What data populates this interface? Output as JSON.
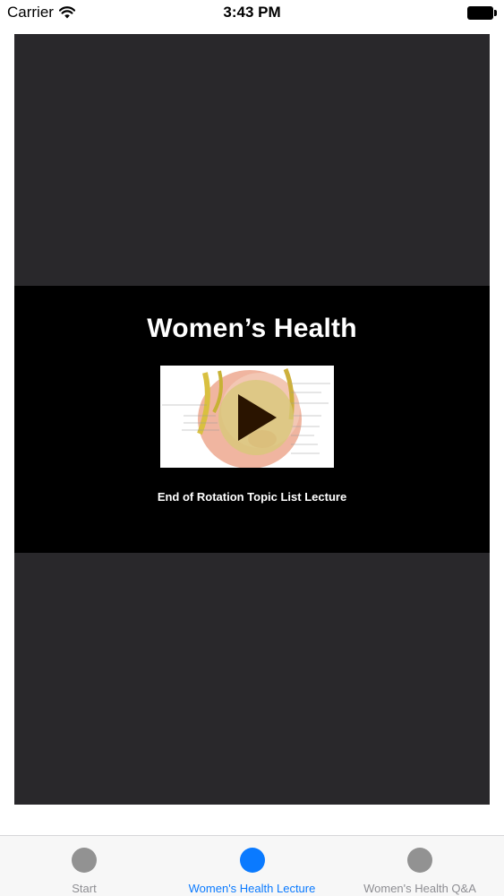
{
  "status_bar": {
    "carrier": "Carrier",
    "time": "3:43 PM",
    "wifi_icon": "wifi-icon",
    "battery_icon": "battery-icon"
  },
  "video": {
    "title": "Women’s Health",
    "subtitle": "End of Rotation Topic List Lecture",
    "play_icon": "play-icon",
    "background_color": "#29282b",
    "frame_color": "#000000"
  },
  "tab_bar": {
    "active_color": "#0a7aff",
    "inactive_color": "#929292",
    "tabs": [
      {
        "label": "Start",
        "active": false
      },
      {
        "label": "Women's Health Lecture",
        "active": true
      },
      {
        "label": "Women's Health Q&A",
        "active": false
      }
    ]
  }
}
